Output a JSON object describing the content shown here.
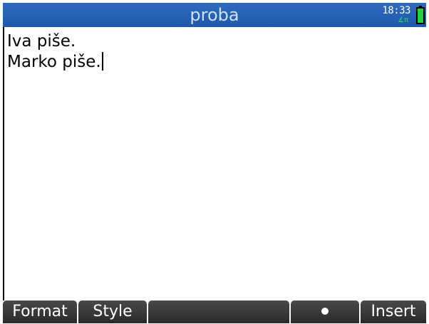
{
  "titlebar": {
    "title": "proba",
    "clock": "18:33",
    "angle_mode": "∡π",
    "battery_color": "#26d13f"
  },
  "editor": {
    "lines": [
      "Iva piše.",
      "Marko piše."
    ]
  },
  "menu": {
    "items": [
      {
        "label": "Format"
      },
      {
        "label": "Style"
      },
      {
        "label": ""
      },
      {
        "label": "•",
        "icon": "dot-icon"
      },
      {
        "label": "Insert"
      }
    ]
  },
  "colors": {
    "titlebar": "#2a64b6",
    "title_text": "#cfe0f8",
    "softkey": "#333333",
    "text": "#000000"
  }
}
